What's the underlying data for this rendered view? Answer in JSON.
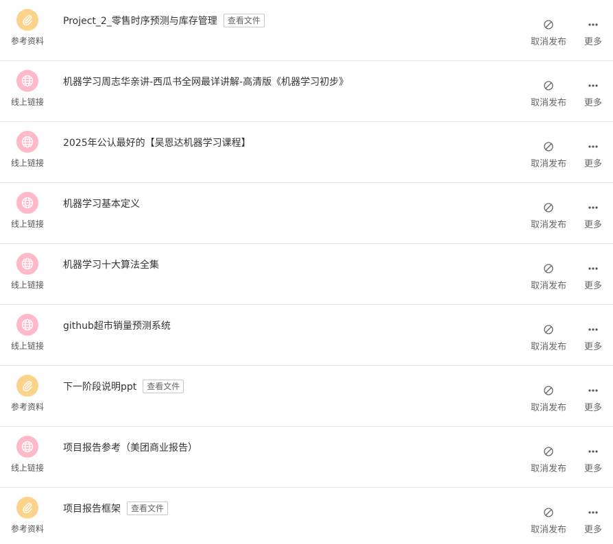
{
  "actions": {
    "cancel_label": "取消发布",
    "more_label": "更多"
  },
  "view_file_label": "查看文件",
  "types": {
    "file": "参考资料",
    "link": "线上链接"
  },
  "colors": {
    "file_badge": "#fcd38a",
    "link_badge": "#ffb9c9"
  },
  "items": [
    {
      "type": "file",
      "type_label": "参考资料",
      "icon": "paperclip-icon",
      "title": "Project_2_零售时序预测与库存管理",
      "has_view_file": true
    },
    {
      "type": "link",
      "type_label": "线上链接",
      "icon": "globe-icon",
      "title": "机器学习周志华亲讲-西瓜书全网最详讲解-高清版《机器学习初步》",
      "has_view_file": false
    },
    {
      "type": "link",
      "type_label": "线上链接",
      "icon": "globe-icon",
      "title": "2025年公认最好的【吴恩达机器学习课程】",
      "has_view_file": false
    },
    {
      "type": "link",
      "type_label": "线上链接",
      "icon": "globe-icon",
      "title": "机器学习基本定义",
      "has_view_file": false
    },
    {
      "type": "link",
      "type_label": "线上链接",
      "icon": "globe-icon",
      "title": "机器学习十大算法全集",
      "has_view_file": false
    },
    {
      "type": "link",
      "type_label": "线上链接",
      "icon": "globe-icon",
      "title": "github超市销量预测系统",
      "has_view_file": false
    },
    {
      "type": "file",
      "type_label": "参考资料",
      "icon": "paperclip-icon",
      "title": "下一阶段说明ppt",
      "has_view_file": true
    },
    {
      "type": "link",
      "type_label": "线上链接",
      "icon": "globe-icon",
      "title": "项目报告参考（美团商业报告）",
      "has_view_file": false
    },
    {
      "type": "file",
      "type_label": "参考资料",
      "icon": "paperclip-icon",
      "title": "项目报告框架",
      "has_view_file": true
    }
  ]
}
